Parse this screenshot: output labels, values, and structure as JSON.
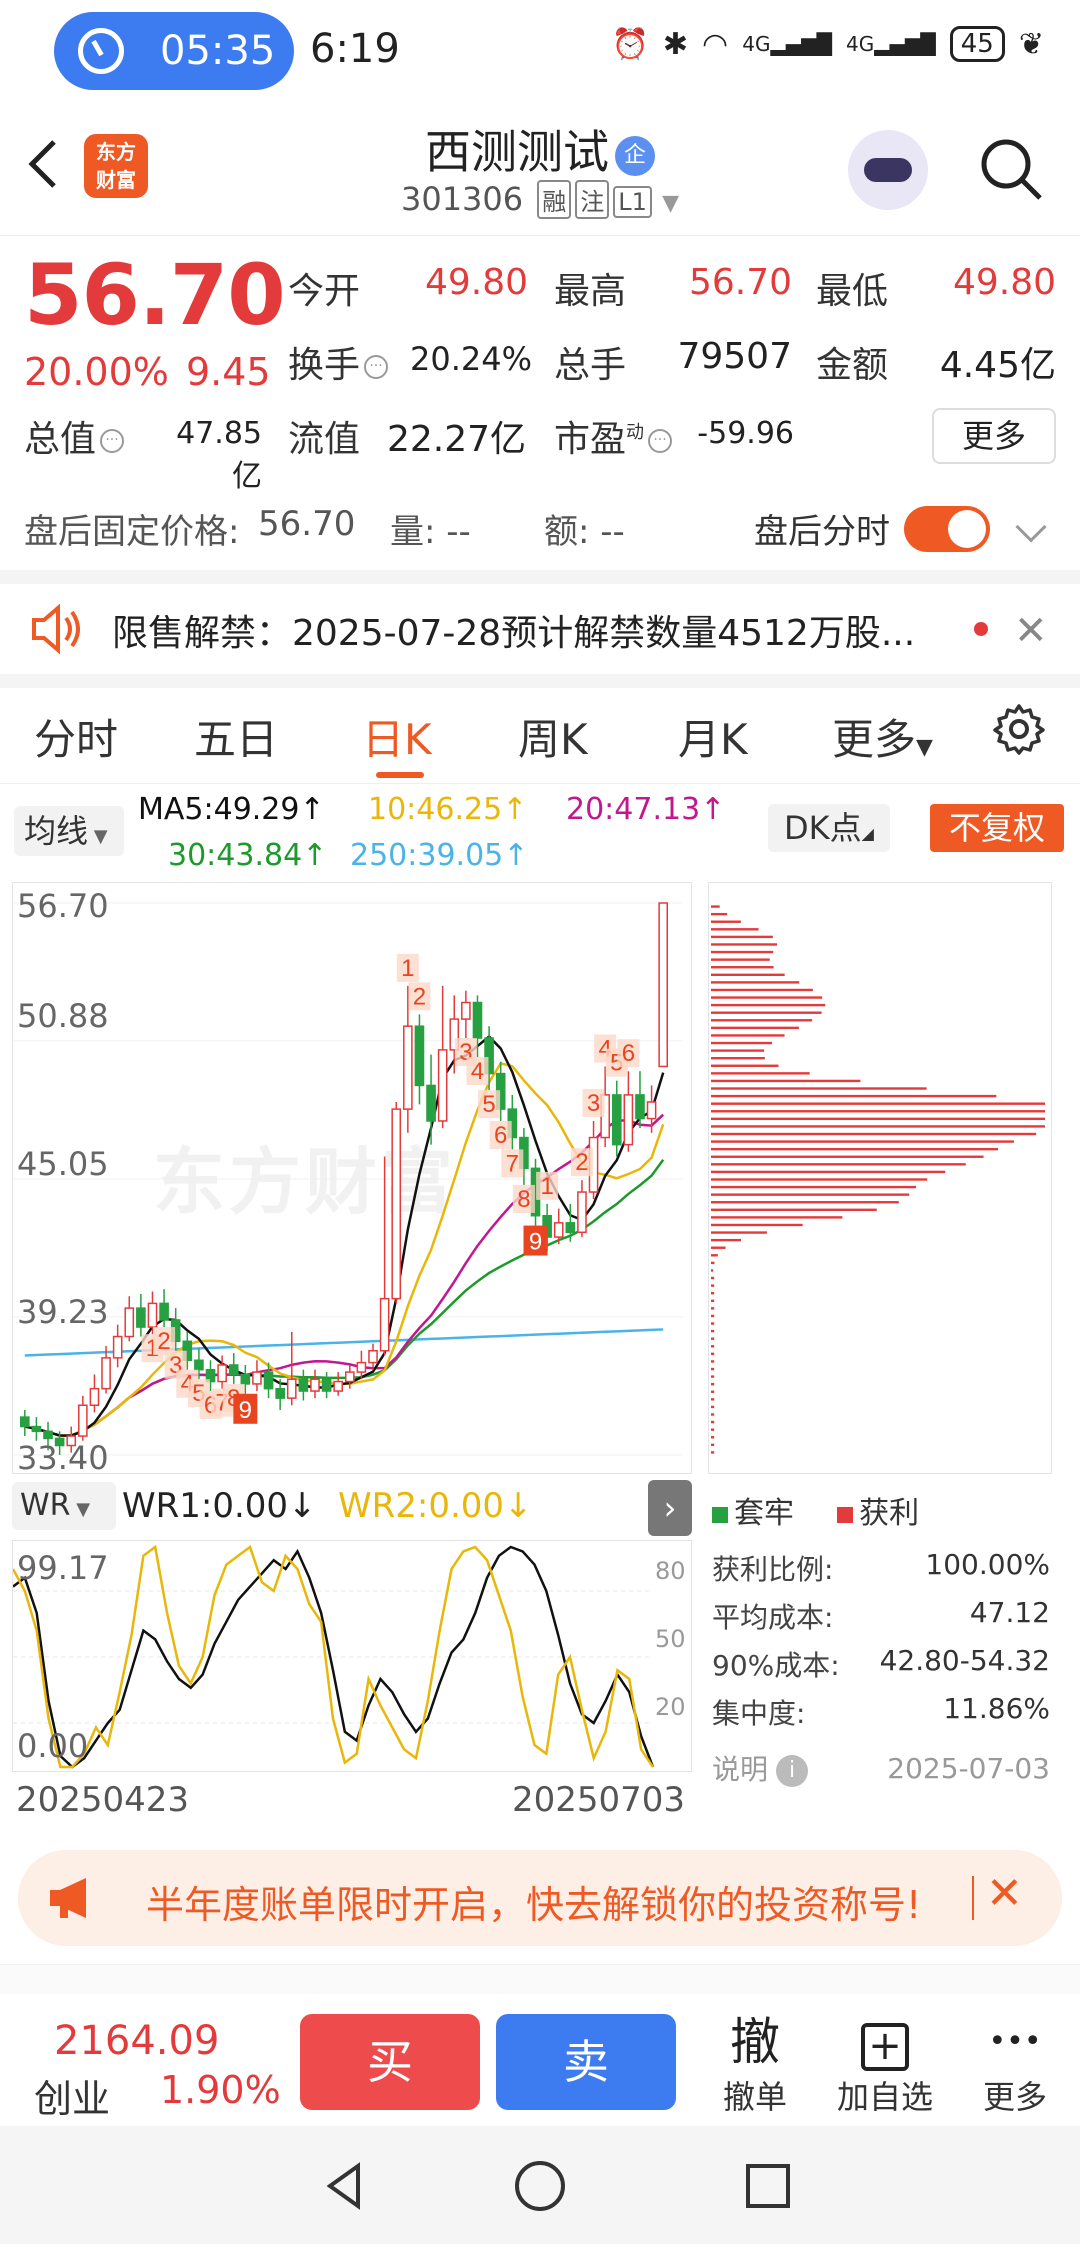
{
  "status_bar": {
    "timer": "05:35",
    "time": "6:19",
    "battery": "45",
    "net1": "4G",
    "net2": "4G"
  },
  "header": {
    "logo_line1": "东方",
    "logo_line2": "财富",
    "stock_name": "西测测试",
    "name_badge": "企",
    "stock_code": "301306",
    "tag_margin": "融",
    "tag_watch": "注",
    "tag_level": "L1"
  },
  "quote": {
    "price": "56.70",
    "change_pct": "20.00%",
    "change_amt": "9.45",
    "open_label": "今开",
    "open": "49.80",
    "high_label": "最高",
    "high": "56.70",
    "low_label": "最低",
    "low": "49.80",
    "turnover_label": "换手",
    "turnover": "20.24%",
    "volume_label": "总手",
    "volume": "79507",
    "amount_label": "金额",
    "amount": "4.45亿",
    "mktcap_label": "总值",
    "mktcap": "47.85亿",
    "float_label": "流值",
    "float_cap": "22.27亿",
    "pe_label": "市盈",
    "pe_super": "动",
    "pe": "-59.96",
    "more_label": "更多"
  },
  "after_hours": {
    "fixed_label": "盘后固定价格:",
    "fixed_price": "56.70",
    "vol_label": "量: --",
    "amt_label": "额: --",
    "toggle_label": "盘后分时"
  },
  "notice": {
    "text": "限售解禁：2025-07-28预计解禁数量4512万股..."
  },
  "tabs": [
    "分时",
    "五日",
    "日K",
    "周K",
    "月K",
    "更多"
  ],
  "ma_bar": {
    "select": "均线",
    "ma5": "MA5:49.29↑",
    "ma10": "10:46.25↑",
    "ma20": "20:47.13↑",
    "ma30": "30:43.84↑",
    "ma250": "250:39.05↑",
    "dk_label": "DK点",
    "fq_label": "不复权",
    "color_ma5": "#111111",
    "color_ma10": "#e9b70a",
    "color_ma20": "#c2178f",
    "color_ma30": "#1e9a2c",
    "color_ma250": "#4ab3e8"
  },
  "kchart": {
    "y_labels": [
      "56.70",
      "50.88",
      "45.05",
      "39.23",
      "33.40"
    ],
    "watermark": "东方财富",
    "up_color": "#e33b3b",
    "down_color": "#26a041",
    "nine_turn_labels": [
      "1",
      "2",
      "3",
      "4",
      "5",
      "6",
      "7",
      "8",
      "9",
      "1",
      "2",
      "3",
      "4",
      "5",
      "6",
      "7",
      "8",
      "9",
      "1",
      "2",
      "3",
      "4",
      "5",
      "6"
    ],
    "candles": [
      [
        35.0,
        34.6,
        35.3,
        34.2
      ],
      [
        34.6,
        34.4,
        35.0,
        34.0
      ],
      [
        34.4,
        34.1,
        34.8,
        33.6
      ],
      [
        34.1,
        33.8,
        34.4,
        33.4
      ],
      [
        33.8,
        34.2,
        34.6,
        33.5
      ],
      [
        34.2,
        35.5,
        35.9,
        34.0
      ],
      [
        35.5,
        36.2,
        36.8,
        35.2
      ],
      [
        36.2,
        37.5,
        38.0,
        36.0
      ],
      [
        37.5,
        38.4,
        38.9,
        37.1
      ],
      [
        38.4,
        39.6,
        40.1,
        38.2
      ],
      [
        39.6,
        38.8,
        40.2,
        38.4
      ],
      [
        38.8,
        39.8,
        40.3,
        38.5
      ],
      [
        39.8,
        39.1,
        40.4,
        38.8
      ],
      [
        39.1,
        38.2,
        39.6,
        37.8
      ],
      [
        38.2,
        37.4,
        38.6,
        37.0
      ],
      [
        37.4,
        37.0,
        37.9,
        36.6
      ],
      [
        37.0,
        36.5,
        37.4,
        36.1
      ],
      [
        36.5,
        37.2,
        37.6,
        36.2
      ],
      [
        37.2,
        36.8,
        37.7,
        36.4
      ],
      [
        36.8,
        36.4,
        37.2,
        35.9
      ],
      [
        36.4,
        36.9,
        37.4,
        36.1
      ],
      [
        36.9,
        36.2,
        37.3,
        35.8
      ],
      [
        36.2,
        35.8,
        36.6,
        35.3
      ],
      [
        35.8,
        36.6,
        38.6,
        35.5
      ],
      [
        36.6,
        36.1,
        37.0,
        35.7
      ],
      [
        36.1,
        36.6,
        37.0,
        35.8
      ],
      [
        36.6,
        36.1,
        36.9,
        35.8
      ],
      [
        36.1,
        36.5,
        36.9,
        35.9
      ],
      [
        36.5,
        36.9,
        37.2,
        36.2
      ],
      [
        36.9,
        37.3,
        37.8,
        36.6
      ],
      [
        37.3,
        37.8,
        38.1,
        37.0
      ],
      [
        37.8,
        40.0,
        46.0,
        37.6
      ],
      [
        40.0,
        48.0,
        48.3,
        39.8
      ],
      [
        48.0,
        51.5,
        53.2,
        47.0
      ],
      [
        51.5,
        49.0,
        52.0,
        48.2
      ],
      [
        49.0,
        47.5,
        50.3,
        46.5
      ],
      [
        47.5,
        50.5,
        53.2,
        47.2
      ],
      [
        50.5,
        51.8,
        52.8,
        49.5
      ],
      [
        51.8,
        52.5,
        53.0,
        51.0
      ],
      [
        52.5,
        51.0,
        52.8,
        50.2
      ],
      [
        51.0,
        49.5,
        51.5,
        48.8
      ],
      [
        49.5,
        48.0,
        50.0,
        47.5
      ],
      [
        48.0,
        46.8,
        48.6,
        46.3
      ],
      [
        46.8,
        45.5,
        47.2,
        44.8
      ],
      [
        45.5,
        43.5,
        45.9,
        43.0
      ],
      [
        43.5,
        42.6,
        44.0,
        42.0
      ],
      [
        42.6,
        43.2,
        43.8,
        42.3
      ],
      [
        43.2,
        42.8,
        44.0,
        42.4
      ],
      [
        42.8,
        44.5,
        45.0,
        42.6
      ],
      [
        44.5,
        46.8,
        47.5,
        44.2
      ],
      [
        46.8,
        48.6,
        49.8,
        46.4
      ],
      [
        48.6,
        46.5,
        49.2,
        46.0
      ],
      [
        46.5,
        48.6,
        49.6,
        46.2
      ],
      [
        48.6,
        47.6,
        49.6,
        47.2
      ],
      [
        47.6,
        48.3,
        49.0,
        47.0
      ],
      [
        49.8,
        56.7,
        56.7,
        49.8
      ]
    ]
  },
  "chip_legend": {
    "trapped": "套牢",
    "profit": "获利",
    "trapped_color": "#26a041",
    "profit_color": "#e33b3b"
  },
  "chip_stats": {
    "profit_ratio_label": "获利比例:",
    "profit_ratio": "100.00%",
    "avg_cost_label": "平均成本:",
    "avg_cost": "47.12",
    "cost90_label": "90%成本:",
    "cost90": "42.80-54.32",
    "concentration_label": "集中度:",
    "concentration": "11.86%",
    "note_label": "说明",
    "date": "2025-07-03"
  },
  "wr": {
    "select": "WR",
    "wr1": "WR1:0.00↓",
    "wr2": "WR2:0.00↓",
    "max": "99.17",
    "min": "0.00",
    "grid": [
      "80",
      "50",
      "20"
    ],
    "wr1_series": [
      82,
      86,
      70,
      30,
      5,
      0,
      4,
      12,
      20,
      26,
      44,
      62,
      58,
      48,
      40,
      36,
      42,
      56,
      66,
      76,
      82,
      88,
      94,
      90,
      98,
      86,
      70,
      44,
      16,
      12,
      28,
      40,
      34,
      24,
      16,
      22,
      38,
      52,
      58,
      70,
      86,
      96,
      100,
      98,
      92,
      80,
      60,
      38,
      24,
      20,
      30,
      42,
      34,
      14,
      0
    ],
    "wr2_series": [
      90,
      80,
      62,
      22,
      0,
      0,
      6,
      18,
      10,
      34,
      60,
      96,
      100,
      70,
      46,
      38,
      50,
      78,
      92,
      96,
      100,
      84,
      80,
      96,
      90,
      74,
      66,
      22,
      2,
      6,
      40,
      28,
      18,
      8,
      4,
      30,
      62,
      90,
      98,
      100,
      94,
      78,
      62,
      32,
      10,
      6,
      42,
      50,
      26,
      4,
      16,
      44,
      40,
      8,
      0
    ]
  },
  "dates": {
    "start": "20250423",
    "end": "20250703"
  },
  "promo": {
    "text": "半年度账单限时开启，快去解锁你的投资称号!"
  },
  "toolbar": {
    "index_value": "2164.09",
    "index_name": "创业",
    "index_pct": "1.90%",
    "buy": "买",
    "sell": "卖",
    "cancel_icon": "撤",
    "cancel": "撤单",
    "add_icon": "+",
    "add": "加自选",
    "more_icon": "•••",
    "more": "更多"
  }
}
